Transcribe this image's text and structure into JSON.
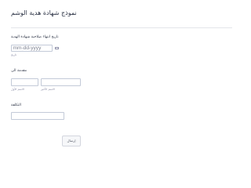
{
  "form": {
    "title": "نموذج شهادة هدية الوشم",
    "expiry_date": {
      "label": "تاريخ انتهاء صلاحية شهادة الهدية",
      "placeholder": "mm-dd-yyyy",
      "sublabel": "تاريخ"
    },
    "presented_to": {
      "label": "مقدمة الى",
      "first_sublabel": "الاسم الأول",
      "last_sublabel": "الاسم الأخير"
    },
    "cost": {
      "label": "التكلفة"
    },
    "submit_label": "إرسال"
  }
}
